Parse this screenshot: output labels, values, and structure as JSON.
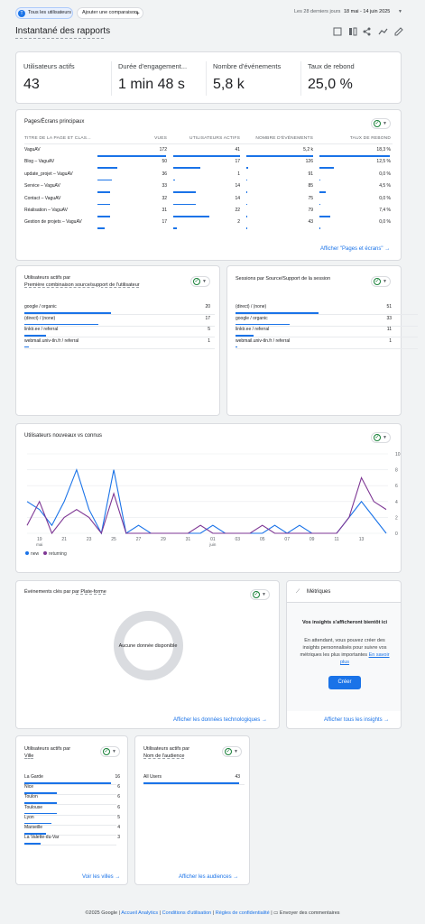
{
  "topbar": {
    "filter_chip": "Tous les utilisateurs",
    "add_compare": "Ajouter une comparaison",
    "date_label": "Les 28 derniers jours",
    "date_range": "18 mai - 14 juin 2025"
  },
  "page_title": "Instantané des rapports",
  "kpis": [
    {
      "label": "Utilisateurs actifs",
      "value": "43"
    },
    {
      "label": "Durée d'engagement...",
      "value": "1 min 48 s"
    },
    {
      "label": "Nombre d'événements",
      "value": "5,8 k"
    },
    {
      "label": "Taux de rebond",
      "value": "25,0 %"
    }
  ],
  "pages": {
    "title": "Pages/Écrans principaux",
    "headers": [
      "TITRE DE LA PAGE ET CLAS...",
      "VUES",
      "UTILISATEURS ACTIFS",
      "NOMBRE D'ÉVÉNEMENTS",
      "TAUX DE REBOND"
    ],
    "rows": [
      [
        "VaguAV",
        "172",
        "41",
        "5,2 k",
        "18,3 %"
      ],
      [
        "Blog – VaguAV",
        "50",
        "17",
        "126",
        "12,5 %"
      ],
      [
        "update_projet – VaguAV",
        "36",
        "1",
        "91",
        "0,0 %"
      ],
      [
        "Service – VaguAV",
        "33",
        "14",
        "85",
        "4,5 %"
      ],
      [
        "Contact – VaguAV",
        "32",
        "14",
        "75",
        "0,0 %"
      ],
      [
        "Réalisation – VaguAV",
        "31",
        "22",
        "79",
        "7,4 %"
      ],
      [
        "Gestion de projets – VaguAV",
        "17",
        "2",
        "43",
        "0,0 %"
      ]
    ],
    "bars": [
      [
        1,
        1,
        1,
        1
      ],
      [
        0.29,
        0.41,
        0.024,
        0.21
      ],
      [
        0.21,
        0.024,
        0.018,
        0
      ],
      [
        0.19,
        0.34,
        0.016,
        0.09
      ],
      [
        0.19,
        0.34,
        0.014,
        0
      ],
      [
        0.18,
        0.54,
        0.015,
        0.15
      ],
      [
        0.1,
        0.05,
        0.008,
        0
      ]
    ],
    "link": "Afficher \"Pages et écrans\""
  },
  "source": {
    "title1": "Utilisateurs actifs par",
    "title2": "Première combinaison source/support de l'utilisateur",
    "rows": [
      [
        "google / organic",
        "20",
        1
      ],
      [
        "(direct) / (none)",
        "17",
        0.85
      ],
      [
        "linktr.ee / referral",
        "5",
        0.25
      ],
      [
        "webmail.univ-tln.fr / referral",
        "1",
        0.05
      ]
    ]
  },
  "sessions": {
    "title": "Sessions par Source/Support de la session",
    "rows": [
      [
        "(direct) / (none)",
        "51",
        1
      ],
      [
        "google / organic",
        "33",
        0.65
      ],
      [
        "linktr.ee / referral",
        "11",
        0.22
      ],
      [
        "webmail.univ-tln.fr / referral",
        "1",
        0.02
      ]
    ]
  },
  "chart_data": {
    "type": "line",
    "title": "Utilisateurs nouveaux vs connus",
    "x_ticks": [
      "19",
      "21",
      "23",
      "25",
      "27",
      "29",
      "31",
      "01",
      "03",
      "05",
      "07",
      "09",
      "11",
      "13"
    ],
    "x_sub": {
      "19": "mai",
      "01": "juin"
    },
    "ylim": [
      0,
      10
    ],
    "y_ticks": [
      "0",
      "2",
      "4",
      "6",
      "8",
      "10"
    ],
    "series": [
      {
        "name": "new",
        "color": "#1a73e8",
        "values": [
          4,
          3,
          1,
          4,
          8,
          3,
          0,
          8,
          0,
          1,
          0,
          0,
          0,
          0,
          0,
          1,
          0,
          0,
          0,
          0,
          1,
          0,
          1,
          0,
          0,
          0,
          2,
          4,
          2,
          0
        ]
      },
      {
        "name": "returning",
        "color": "#7e3794",
        "values": [
          1,
          4,
          0,
          2,
          3,
          2,
          0,
          5,
          0,
          0,
          0,
          0,
          0,
          0,
          1,
          0,
          0,
          0,
          0,
          1,
          0,
          0,
          0,
          0,
          0,
          0,
          2,
          7,
          4,
          3
        ]
      }
    ]
  },
  "events": {
    "title1": "Événements clés",
    "title2": "par Plate-forme",
    "empty": "Aucune donnée disponible",
    "link": "Afficher les données technologiques"
  },
  "insights": {
    "header": "Métriques",
    "title": "Vos insights s'afficheront bientôt ici",
    "body": "En attendant, vous pouvez créer des insights personnalisés pour suivre vos métriques les plus importantes",
    "learn": "En savoir plus",
    "button": "Créer",
    "link": "Afficher tous les insights"
  },
  "cities": {
    "title1": "Utilisateurs actifs",
    "title2": "par",
    "title3": "Ville",
    "rows": [
      [
        "La Garde",
        "16",
        1
      ],
      [
        "Nice",
        "6",
        0.38
      ],
      [
        "Toulon",
        "6",
        0.38
      ],
      [
        "Toulouse",
        "6",
        0.38
      ],
      [
        "Lyon",
        "5",
        0.31
      ],
      [
        "Marseille",
        "4",
        0.25
      ],
      [
        "La Valette-du-Var",
        "3",
        0.19
      ]
    ],
    "link": "Voir les villes"
  },
  "audience": {
    "title1": "Utilisateurs actifs",
    "title2": "par",
    "title3": "Nom de l'audience",
    "rows": [
      [
        "All Users",
        "43",
        1
      ]
    ],
    "link": "Afficher les audiences"
  },
  "footer": {
    "copyright": "©2025 Google",
    "links": [
      "Accueil Analytics",
      "Conditions d'utilisation",
      "Règles de confidentialité"
    ],
    "feedback": "Envoyer des commentaires"
  }
}
